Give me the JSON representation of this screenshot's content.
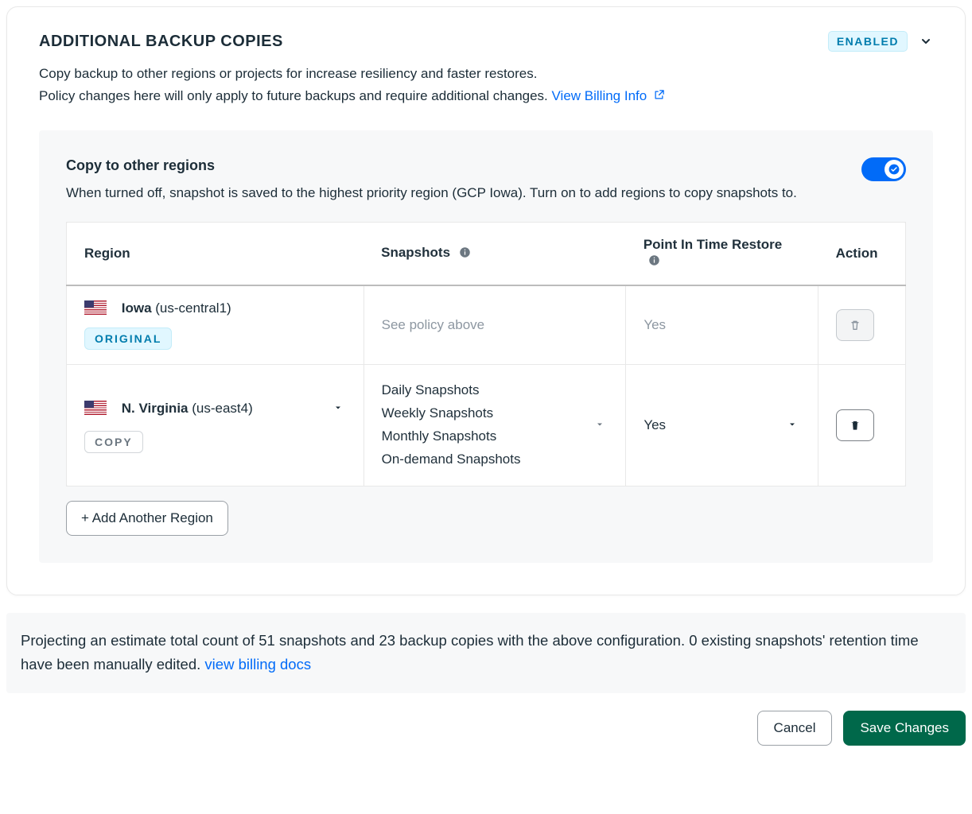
{
  "header": {
    "title": "ADDITIONAL BACKUP COPIES",
    "enabled_label": "ENABLED",
    "desc_line1": "Copy backup to other regions or projects for increase resiliency and faster restores.",
    "desc_line2": "Policy changes here will only apply to future backups and require additional changes. ",
    "billing_link": "View Billing Info"
  },
  "regions_panel": {
    "title": "Copy to other regions",
    "desc": "When turned off, snapshot is saved to the highest priority region (GCP Iowa). Turn on to add regions to copy snapshots to.",
    "toggle_on": true,
    "columns": {
      "region": "Region",
      "snapshots": "Snapshots",
      "pitr": "Point In Time Restore",
      "action": "Action"
    },
    "rows": [
      {
        "name": "Iowa",
        "code": "(us-central1)",
        "badge": "ORIGINAL",
        "snapshots_text": "See policy above",
        "pitr": "Yes",
        "editable": false
      },
      {
        "name": "N. Virginia",
        "code": "(us-east4)",
        "badge": "COPY",
        "snapshots_list": [
          "Daily Snapshots",
          "Weekly Snapshots",
          "Monthly Snapshots",
          "On-demand Snapshots"
        ],
        "pitr": "Yes",
        "editable": true
      }
    ],
    "add_region_label": "+ Add Another Region"
  },
  "estimate": {
    "text": "Projecting an estimate total count of 51 snapshots and 23 backup copies with the above configuration. 0 existing snapshots' retention time have been manually edited.  ",
    "link": "view billing docs"
  },
  "footer": {
    "cancel": "Cancel",
    "save": "Save Changes"
  }
}
